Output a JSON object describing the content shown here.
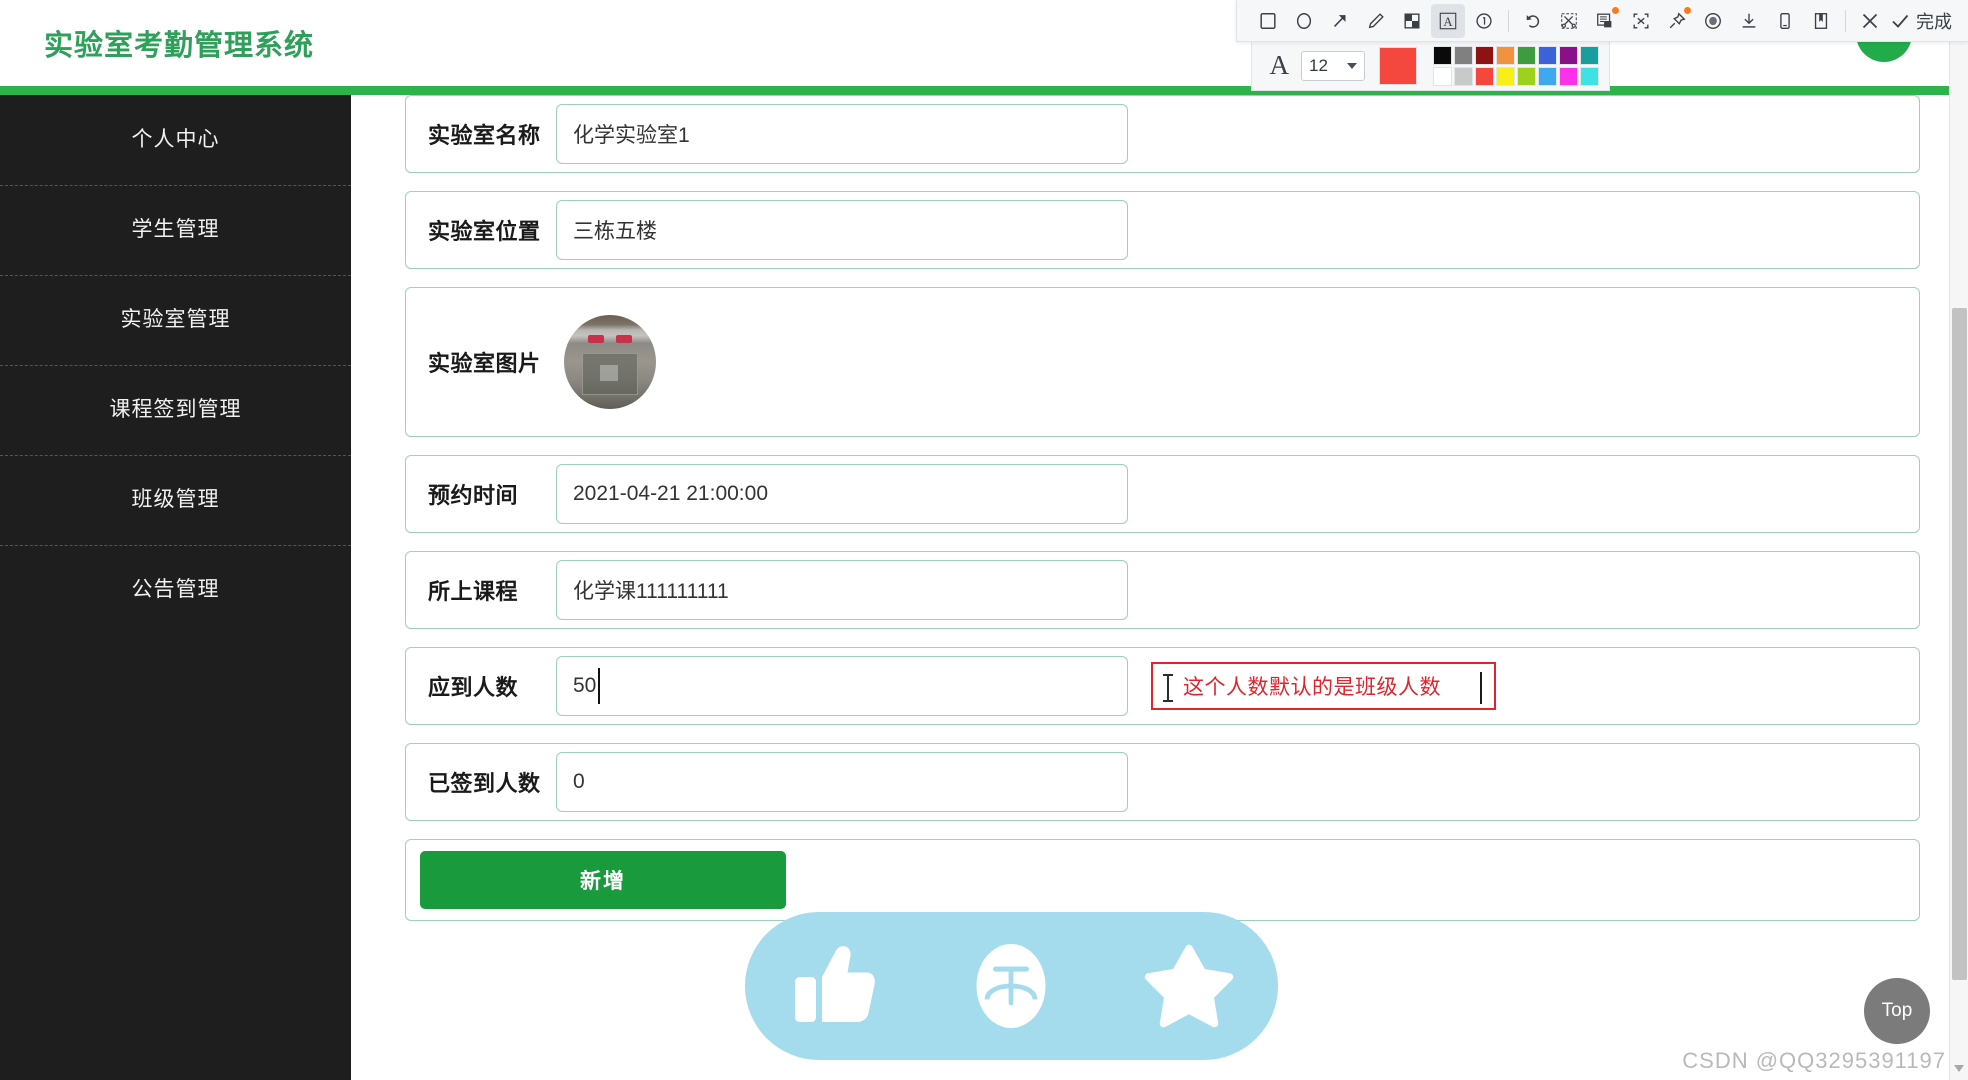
{
  "header": {
    "title": "实验室考勤管理系统",
    "avatar_name": "user-avatar"
  },
  "sidebar": {
    "items": [
      {
        "label": "个人中心"
      },
      {
        "label": "学生管理"
      },
      {
        "label": "实验室管理"
      },
      {
        "label": "课程签到管理"
      },
      {
        "label": "班级管理"
      },
      {
        "label": "公告管理"
      }
    ]
  },
  "form": {
    "rows": [
      {
        "label": "实验室名称",
        "value": "化学实验室1",
        "type": "text"
      },
      {
        "label": "实验室位置",
        "value": "三栋五楼",
        "type": "text"
      },
      {
        "label": "实验室图片",
        "value": "",
        "type": "image"
      },
      {
        "label": "预约时间",
        "value": "2021-04-21 21:00:00",
        "type": "text"
      },
      {
        "label": "所上课程",
        "value": "化学课111111111",
        "type": "text"
      },
      {
        "label": "应到人数",
        "value": "50",
        "type": "text-caret"
      },
      {
        "label": "已签到人数",
        "value": "0",
        "type": "text"
      }
    ],
    "submit_label": "新增"
  },
  "annotation": {
    "text": "这个人数默认的是班级人数",
    "border_color": "#e0242c",
    "text_color": "#e0242c"
  },
  "action_pill": {
    "background": "#a5dced",
    "items": [
      {
        "icon": "thumbs-up-icon"
      },
      {
        "icon": "reward-umbrella-icon"
      },
      {
        "icon": "star-icon"
      }
    ]
  },
  "top_button": {
    "label": "Top"
  },
  "watermark": {
    "text": "CSDN @QQ3295391197"
  },
  "screenshot_toolbar": {
    "tools": [
      {
        "name": "rectangle-tool",
        "glyph": "▢"
      },
      {
        "name": "ellipse-tool",
        "glyph": "◯"
      },
      {
        "name": "arrow-tool",
        "glyph": "↗"
      },
      {
        "name": "pencil-tool",
        "glyph": "✎"
      },
      {
        "name": "mosaic-tool",
        "glyph": "▧"
      },
      {
        "name": "text-tool",
        "glyph": "A",
        "active": true
      },
      {
        "name": "serial-number-tool",
        "glyph": "①"
      },
      {
        "name": "undo-tool",
        "glyph": "↺"
      },
      {
        "name": "crop-scissors-tool",
        "glyph": "✂"
      },
      {
        "name": "ocr-translate-tool",
        "glyph": "▤",
        "badge": true
      },
      {
        "name": "extract-text-tool",
        "glyph": "⌈x⌋"
      },
      {
        "name": "pin-tool",
        "glyph": "📌",
        "badge": true
      },
      {
        "name": "record-tool",
        "glyph": "◉"
      },
      {
        "name": "download-tool",
        "glyph": "⤓"
      },
      {
        "name": "send-to-phone-tool",
        "glyph": "▯"
      },
      {
        "name": "bookmark-tool",
        "glyph": "🔖"
      }
    ],
    "cancel_glyph": "✕",
    "done_check": "✓",
    "done_label": "完成",
    "font_letter": "A",
    "font_size": "12",
    "current_color": "#f4483e",
    "palette_row1": [
      "#0a0a0a",
      "#808080",
      "#8e1212",
      "#ef9340",
      "#3f9b3f",
      "#3a63d8",
      "#8a0f8a",
      "#189e9e"
    ],
    "palette_row2": [
      "#ffffff",
      "#c9c9c9",
      "#f4483e",
      "#f7ef1a",
      "#9ed11e",
      "#3ea9ef",
      "#fc32e8",
      "#3fe2e2"
    ]
  },
  "scrollbars": {
    "page_thumb_name": "page-scrollbar-thumb"
  }
}
